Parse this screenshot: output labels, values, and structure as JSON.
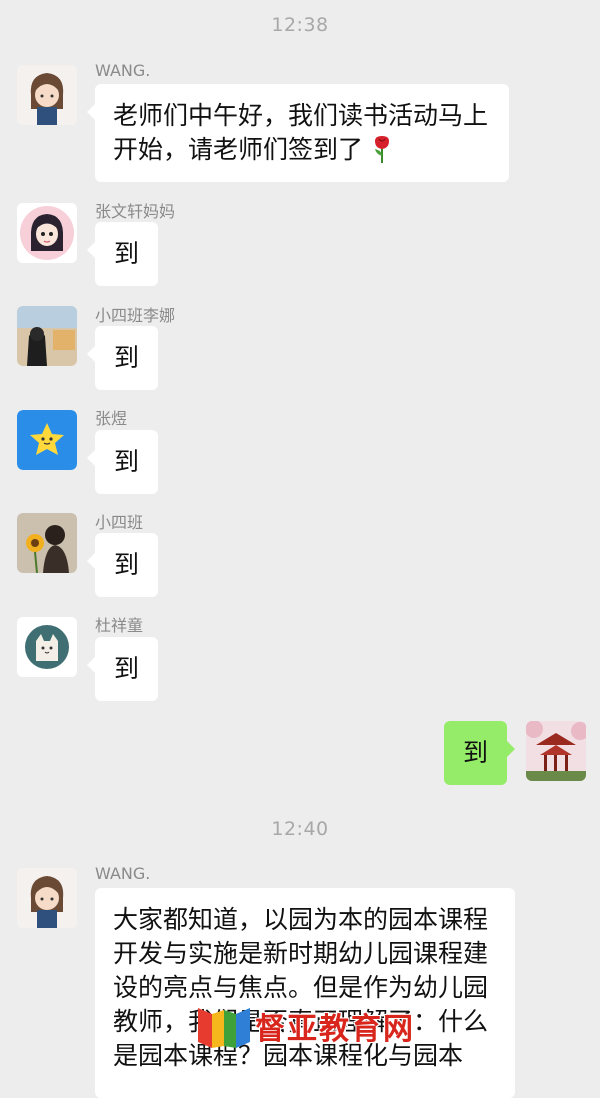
{
  "timestamps": [
    "12:38",
    "12:40"
  ],
  "messages": [
    {
      "sender": "WANG.",
      "text": "老师们中午好，我们读书活动马上开始，请老师们签到了"
    },
    {
      "sender": "张文轩妈妈",
      "text": "到"
    },
    {
      "sender": "小四班李娜",
      "text": "到"
    },
    {
      "sender": "张煜",
      "text": "到"
    },
    {
      "sender": "小四班",
      "text": "到"
    },
    {
      "sender": "杜祥童",
      "text": "到"
    },
    {
      "sender": "",
      "text": "到"
    },
    {
      "sender": "WANG.",
      "text": "大家都知道，以园为本的园本课程开发与实施是新时期幼儿园课程建设的亮点与焦点。但是作为幼儿园教师，我们是否真正理解了：什么是园本课程？园本课程化与园本"
    }
  ],
  "watermark": "督亚教育网",
  "colors": {
    "background": "#ededed",
    "bubble_in": "#ffffff",
    "bubble_out": "#95ec69",
    "meta_text": "#8a8a8a",
    "time_text": "#a8a8a8"
  },
  "icons": [
    "rose-emoji",
    "avatar-wang",
    "avatar-zhangwenxuan",
    "avatar-lina",
    "avatar-star",
    "avatar-sunflower",
    "avatar-cat",
    "avatar-pavilion",
    "watermark-book-logo"
  ]
}
